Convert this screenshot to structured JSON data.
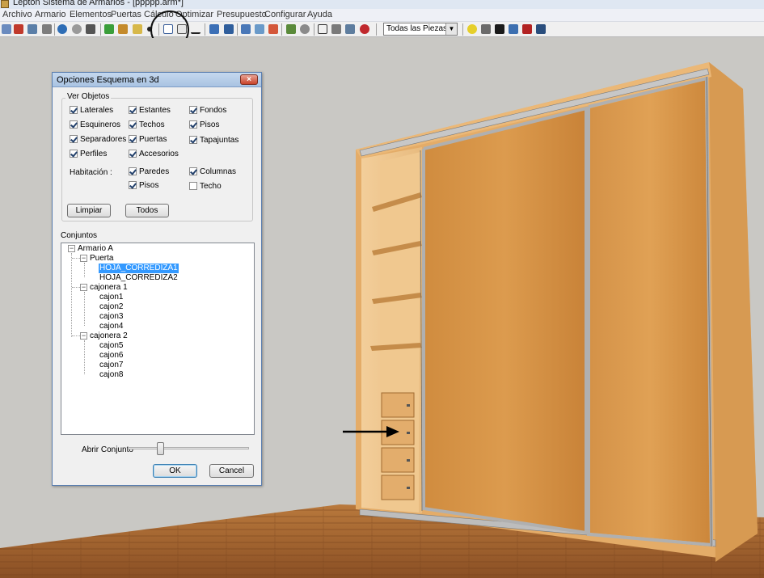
{
  "window": {
    "title": "Lepton Sistema de Armarios - [ppppp.arm*]"
  },
  "menu": [
    "Archivo",
    "Armario",
    "Elementos",
    "Puertas",
    "Cálculo",
    "Optimizar",
    "Presupuesto",
    "Configurar",
    "Ayuda"
  ],
  "toolbar": {
    "pieces_filter": "Todas las Piezas"
  },
  "dialog": {
    "title": "Opciones Esquema en 3d",
    "close_label": "×",
    "ver_objetos_label": "Ver Objetos",
    "checkboxes": [
      {
        "label": "Laterales",
        "checked": true
      },
      {
        "label": "Estantes",
        "checked": true
      },
      {
        "label": "Fondos",
        "checked": true
      },
      {
        "label": "Esquineros",
        "checked": true
      },
      {
        "label": "Techos",
        "checked": true
      },
      {
        "label": "Pisos",
        "checked": true
      },
      {
        "label": "Separadores",
        "checked": true
      },
      {
        "label": "Puertas",
        "checked": true
      },
      {
        "label": "Tapajuntas",
        "checked": true
      },
      {
        "label": "Perfiles",
        "checked": true
      },
      {
        "label": "Accesorios",
        "checked": true
      }
    ],
    "habitacion_label": "Habitación :",
    "habitacion_checkboxes": [
      {
        "label": "Paredes",
        "checked": true
      },
      {
        "label": "Columnas",
        "checked": true
      },
      {
        "label": "Pisos",
        "checked": true
      },
      {
        "label": "Techo",
        "checked": false
      }
    ],
    "limpiar_label": "Limpiar",
    "todos_label": "Todos",
    "conjuntos_label": "Conjuntos",
    "tree": {
      "root": "Armario A",
      "puerta": "Puerta",
      "hoja1": "HOJA_CORREDIZA1",
      "hoja2": "HOJA_CORREDIZA2",
      "cajonera1": "cajonera 1",
      "c1": "cajon1",
      "c2": "cajon2",
      "c3": "cajon3",
      "c4": "cajon4",
      "cajonera2": "cajonera 2",
      "c5": "cajon5",
      "c6": "cajon6",
      "c7": "cajon7",
      "c8": "cajon8",
      "expander_open": "−"
    },
    "slider_label": "Abrir Conjunto",
    "slider_value": 0.25,
    "ok_label": "OK",
    "cancel_label": "Cancel"
  }
}
